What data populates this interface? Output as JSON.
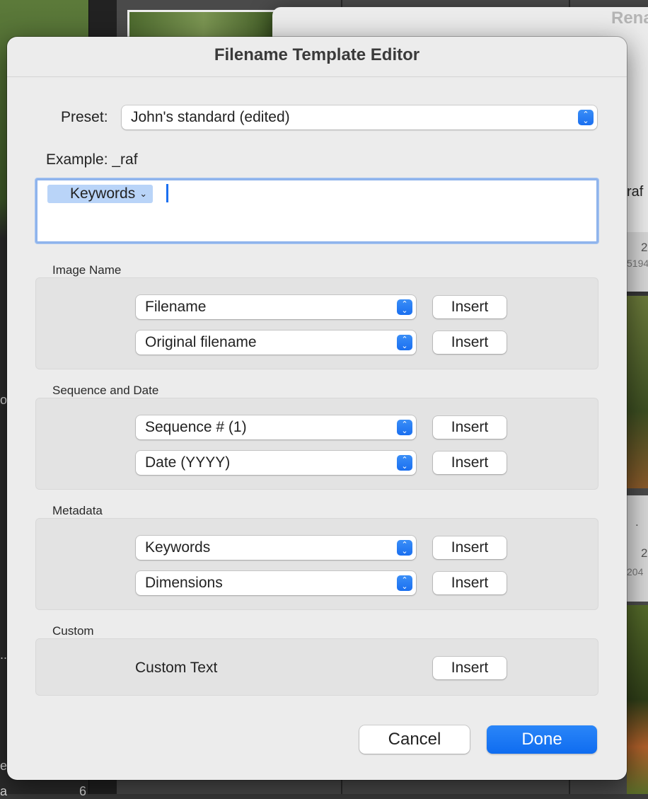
{
  "background": {
    "rear_dialog_title": "Rena",
    "rear_side_text": "raf",
    "right_cells": [
      "2",
      "5194",
      ".",
      "2",
      "204"
    ],
    "left_side_texts": [
      "ov",
      "...",
      "e",
      "a",
      "6"
    ]
  },
  "dialog": {
    "title": "Filename Template Editor",
    "preset_label": "Preset:",
    "preset_value": "John's standard (edited)",
    "example_label": "Example:  _raf",
    "token_label": "Keywords",
    "sections": [
      {
        "label": "Image Name",
        "rows": [
          {
            "popup": "Filename",
            "button": "Insert"
          },
          {
            "popup": "Original filename",
            "button": "Insert"
          }
        ]
      },
      {
        "label": "Sequence and Date",
        "rows": [
          {
            "popup": "Sequence # (1)",
            "button": "Insert"
          },
          {
            "popup": "Date (YYYY)",
            "button": "Insert"
          }
        ]
      },
      {
        "label": "Metadata",
        "rows": [
          {
            "popup": "Keywords",
            "button": "Insert"
          },
          {
            "popup": "Dimensions",
            "button": "Insert"
          }
        ]
      }
    ],
    "custom": {
      "label": "Custom",
      "text": "Custom Text",
      "button": "Insert"
    },
    "cancel_label": "Cancel",
    "done_label": "Done"
  },
  "colors": {
    "accent": "#1a6ff0",
    "token_bg": "#b9d4f8",
    "focus_ring": "#8fb4ec"
  }
}
